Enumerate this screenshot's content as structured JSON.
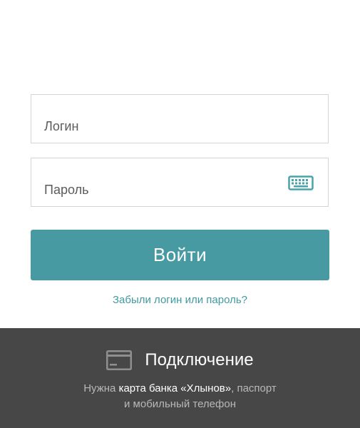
{
  "login_form": {
    "login_placeholder": "Логин",
    "password_placeholder": "Пароль",
    "keyboard_icon": "keyboard-icon",
    "submit_label": "Войти",
    "forgot_link": "Забыли логин или пароль?"
  },
  "connect": {
    "icon": "card-icon",
    "title": "Подключение",
    "desc_prefix": "Нужна ",
    "desc_highlight": "карта банка «Хлынов»",
    "desc_suffix": ", паспорт",
    "desc_line2": "и мобильный телефон"
  },
  "colors": {
    "accent": "#4799a2",
    "link": "#3f9aa2",
    "panel_bg": "#474747"
  }
}
